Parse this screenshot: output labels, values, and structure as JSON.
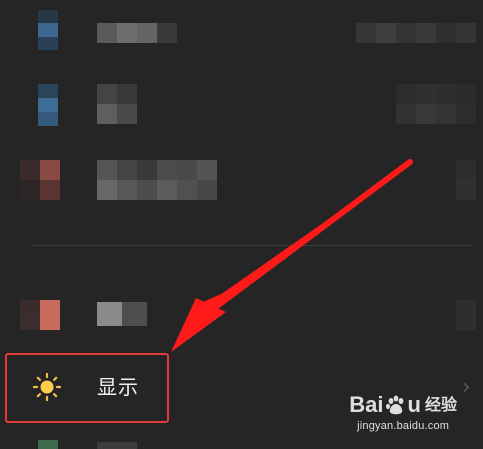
{
  "settings_list": {
    "display_item": {
      "label": "显示",
      "icon": "sun-icon",
      "chevron": "›"
    }
  },
  "annotation": {
    "highlight_color": "#e03c3c",
    "arrow_color": "#ff1a1a"
  },
  "watermark": {
    "brand_left": "Bai",
    "brand_right": "u",
    "brand_suffix": "经验",
    "url": "jingyan.baidu.com"
  }
}
